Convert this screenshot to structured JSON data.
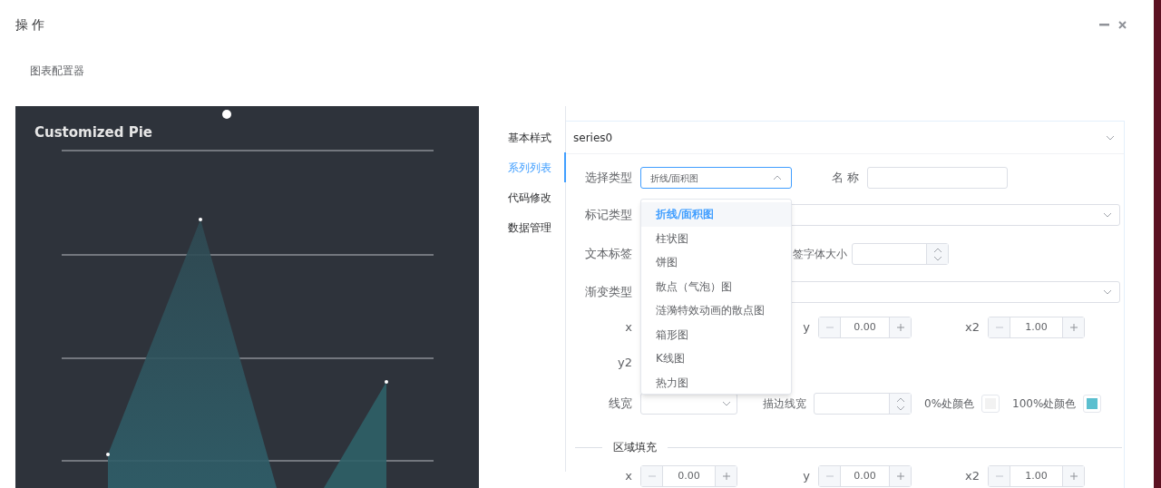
{
  "dialog": {
    "title": "操 作"
  },
  "page_title": "图表配置器",
  "chart": {
    "title": "Customized Pie"
  },
  "tabs": [
    {
      "label": "基本样式",
      "selected": false
    },
    {
      "label": "系列列表",
      "selected": true
    },
    {
      "label": "代码修改",
      "selected": false
    },
    {
      "label": "数据管理",
      "selected": false
    }
  ],
  "series": {
    "name": "series0"
  },
  "type_select": {
    "label": "选择类型",
    "value": "折线/面积图",
    "open": true,
    "options": [
      {
        "label": "折线/面积图",
        "selected": true
      },
      {
        "label": "柱状图",
        "selected": false
      },
      {
        "label": "饼图",
        "selected": false
      },
      {
        "label": "散点（气泡）图",
        "selected": false
      },
      {
        "label": "涟漪特效动画的散点图",
        "selected": false
      },
      {
        "label": "箱形图",
        "selected": false
      },
      {
        "label": "K线图",
        "selected": false
      },
      {
        "label": "热力图",
        "selected": false
      }
    ]
  },
  "name_field": {
    "label": "名 称"
  },
  "mark_type": {
    "label": "标记类型"
  },
  "text_label": {
    "label": "文本标签",
    "font_size_label": "签字体大小"
  },
  "gradient_type": {
    "label": "渐变类型"
  },
  "gradient": {
    "x": {
      "label": "x"
    },
    "y": {
      "label": "y",
      "value": "0.00"
    },
    "x2": {
      "label": "x2",
      "value": "1.00"
    },
    "y2": {
      "label": "y2"
    }
  },
  "line_width": {
    "label": "线宽"
  },
  "stroke_width": {
    "label": "描边线宽"
  },
  "color_stops": [
    {
      "label": "0%处颜色",
      "color": "#f2f2f2"
    },
    {
      "label": "100%处颜色",
      "color": "#5bbfcf"
    }
  ],
  "area_fill": {
    "title": "区域填充",
    "fields": [
      {
        "label": "x",
        "value": "0.00"
      },
      {
        "label": "y",
        "value": "0.00"
      },
      {
        "label": "x2",
        "value": "1.00"
      }
    ]
  }
}
